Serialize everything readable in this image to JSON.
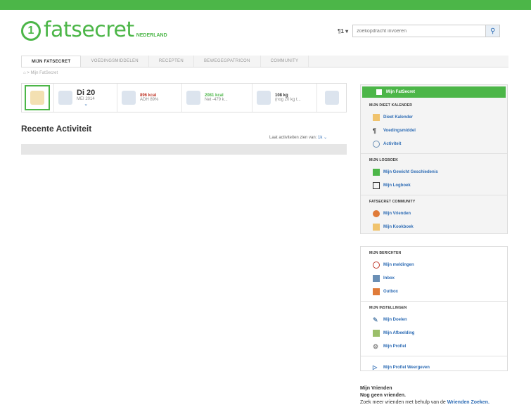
{
  "brand": {
    "name": "fatsecret",
    "region": "NEDERLAND",
    "accent": "#4cb648"
  },
  "search": {
    "selector": "¶1 ▾",
    "placeholder": "zoekopdracht invoeren"
  },
  "tabs": [
    "MIJN FATSECRET",
    "VOEDINGSMIDDELEN",
    "RECEPTEN",
    "BEWEGEGPATRICON",
    "COMMUNITY"
  ],
  "breadcrumb": "Mijn FatSecret",
  "stats": {
    "date": {
      "day": "Di 20",
      "month": "MEI 2014"
    },
    "food": {
      "line1": "896 kcal",
      "line2": "ADH 89%"
    },
    "activity": {
      "line1": "2081 kcal",
      "line2": "Net -479 k..."
    },
    "weight": {
      "line1": "108 kg",
      "line2": "(nog 20 kg t..."
    }
  },
  "main": {
    "heading": "Recente Activiteit",
    "filter_label": "Laat activiteiten zien van:",
    "filter_value": "1k"
  },
  "sidebar1": {
    "header": "Mijn FatSecret",
    "sections": [
      {
        "title": "MIJN DIEET KALENDER",
        "items": [
          "Dieet Kalender",
          "Voedingsmiddel",
          "Activiteit"
        ]
      },
      {
        "title": "MIJN LOGBOEK",
        "items": [
          "Mijn Gewicht Geschiedenis",
          "Mijn Logboek"
        ]
      },
      {
        "title": "FATSECRET COMMUNITY",
        "items": [
          "Mijn Vrienden",
          "Mijn Kookboek"
        ]
      }
    ]
  },
  "sidebar2": {
    "sections": [
      {
        "title": "MIJN BERICHTEN",
        "items": [
          "Mijn meldingen",
          "Inbox",
          "Outbox"
        ]
      },
      {
        "title": "MIJN INSTELLINGEN",
        "items": [
          "Mijn Doelen",
          "Mijn Afbeelding",
          "Mijn Profiel"
        ]
      },
      {
        "title": "",
        "items": [
          "Mijn Profiel Weergeven"
        ]
      }
    ]
  },
  "friends": {
    "title": "Mijn Vrienden",
    "empty": "Nog geen vrienden.",
    "prompt": "Zoek meer vrienden met behulp van de",
    "link": "Wrienden Zoeken."
  }
}
